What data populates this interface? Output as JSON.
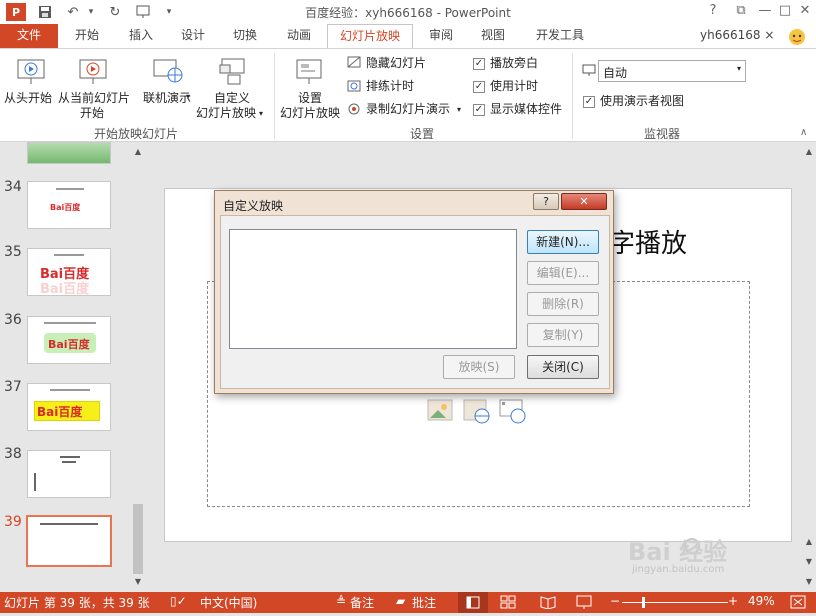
{
  "window": {
    "title": "百度经验：xyh666168 - PowerPoint",
    "help": "?",
    "restore": "⧉",
    "minimize": "—",
    "maximize": "□",
    "close": "✕"
  },
  "quick_access": {
    "save_icon": "save-icon",
    "undo_icon": "undo-icon",
    "redo_icon": "redo-icon",
    "start_icon": "slideshow-icon"
  },
  "tabs": [
    "文件",
    "开始",
    "插入",
    "设计",
    "切换",
    "动画",
    "幻灯片放映",
    "审阅",
    "视图",
    "开发工具"
  ],
  "user": "yh666168 ×",
  "ribbon": {
    "start_group": {
      "from_beginning": "从头开始",
      "from_current_1": "从当前幻灯片",
      "from_current_2": "开始",
      "online_present": "联机演示",
      "custom_1": "自定义",
      "custom_2": "幻灯片放映",
      "label": "开始放映幻灯片"
    },
    "setup_group": {
      "setup_1": "设置",
      "setup_2": "幻灯片放映",
      "hide_slide": "隐藏幻灯片",
      "rehearse": "排练计时",
      "record": "录制幻灯片演示",
      "play_narrations": "播放旁白",
      "use_timings": "使用计时",
      "show_media": "显示媒体控件",
      "label": "设置"
    },
    "monitor_group": {
      "monitor_value": "自动",
      "presenter_view": "使用演示者视图",
      "label": "监视器"
    }
  },
  "slides": [
    {
      "number": "34",
      "caption": "Bai百度"
    },
    {
      "number": "35",
      "caption": "Bai百度"
    },
    {
      "number": "36",
      "caption": "Bai百度"
    },
    {
      "number": "37",
      "caption": "Bai百度"
    },
    {
      "number": "38",
      "caption": ""
    },
    {
      "number": "39",
      "caption": ""
    }
  ],
  "slide_title_fragment": "字播放",
  "dialog": {
    "title": "自定义放映",
    "help": "?",
    "close": "✕",
    "new": "新建(N)...",
    "edit": "编辑(E)...",
    "delete": "删除(R)",
    "copy": "复制(Y)",
    "show": "放映(S)",
    "close_btn": "关闭(C)"
  },
  "status": {
    "slide_info": "幻灯片 第 39 张，共 39 张",
    "language": "中文(中国)",
    "notes": "备注",
    "comments": "批注",
    "zoom": "49%"
  },
  "watermark": {
    "brand": "Bai 经验",
    "url": "jingyan.baidu.com"
  },
  "colors": {
    "accent": "#d24726",
    "selected_slide": "#e8754f"
  }
}
